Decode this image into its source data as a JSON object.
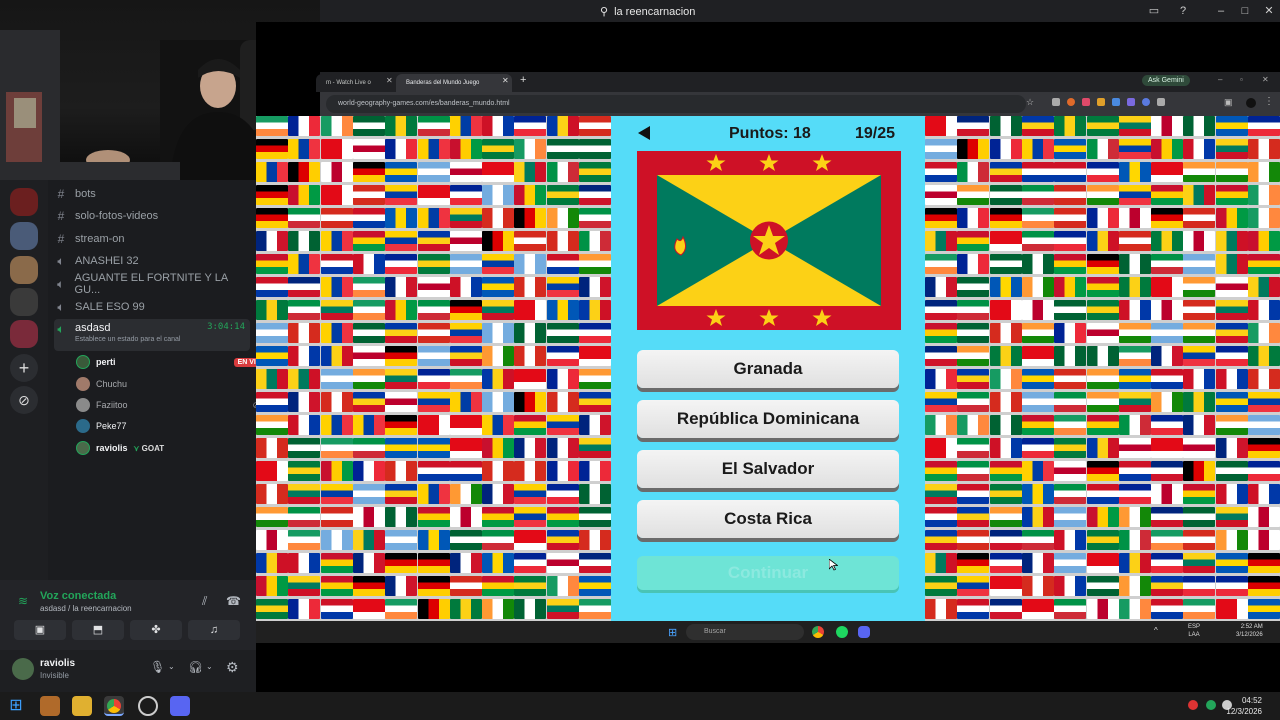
{
  "window": {
    "title": "la reencarnacion"
  },
  "discord": {
    "channels": [
      {
        "type": "text",
        "name": "bots"
      },
      {
        "type": "text",
        "name": "solo-fotos-videos"
      },
      {
        "type": "text",
        "name": "stream-on"
      },
      {
        "type": "voice",
        "name": "ANASHEI 32"
      },
      {
        "type": "voice",
        "name": "AGUANTE EL FORTNITE Y LA GU..."
      },
      {
        "type": "voice",
        "name": "SALE ESO 99"
      }
    ],
    "active_channel": {
      "name": "asdasd",
      "timer": "3:04:14",
      "status_hint": "Establece un estado para el canal"
    },
    "voice_users": [
      {
        "name": "perti",
        "badge": "EN VIVO"
      },
      {
        "name": "Chuchu",
        "badge": ""
      },
      {
        "name": "Faziitoo",
        "badge": ""
      },
      {
        "name": "Peke77",
        "badge": ""
      },
      {
        "name": "raviolis",
        "badge": "GOAT"
      }
    ],
    "voice_panel": {
      "status": "Voz conectada",
      "location": "asdasd / la reencarnacion"
    },
    "user": {
      "name": "raviolis",
      "status": "Invisible"
    }
  },
  "browser": {
    "tabs": [
      {
        "label": "m - Watch Live o",
        "active": false
      },
      {
        "label": "Banderas del Mundo Juego",
        "active": true
      }
    ],
    "new_tab": "+",
    "gemini": "Ask Gemini",
    "url": "world-geography-games.com/es/banderas_mundo.html"
  },
  "quiz": {
    "score_label": "Puntos: 18",
    "progress": "19/25",
    "flag_name_icon": "grenada-flag",
    "options": [
      "Granada",
      "República Dominicana",
      "El Salvador",
      "Costa Rica"
    ],
    "continue_label": "Continuar"
  },
  "remote_taskbar": {
    "search": "Buscar",
    "lang": "ESP",
    "lang2": "LAA",
    "time": "2:52 AM",
    "date": "3/12/2026"
  },
  "taskbar": {
    "time": "04:52",
    "date": "12/3/2026"
  },
  "colors": {
    "quiz_bg": "#55dcf8",
    "discord_bg": "#1b1c1f",
    "live_badge": "#d83c3e",
    "voice_green": "#23a55a"
  }
}
